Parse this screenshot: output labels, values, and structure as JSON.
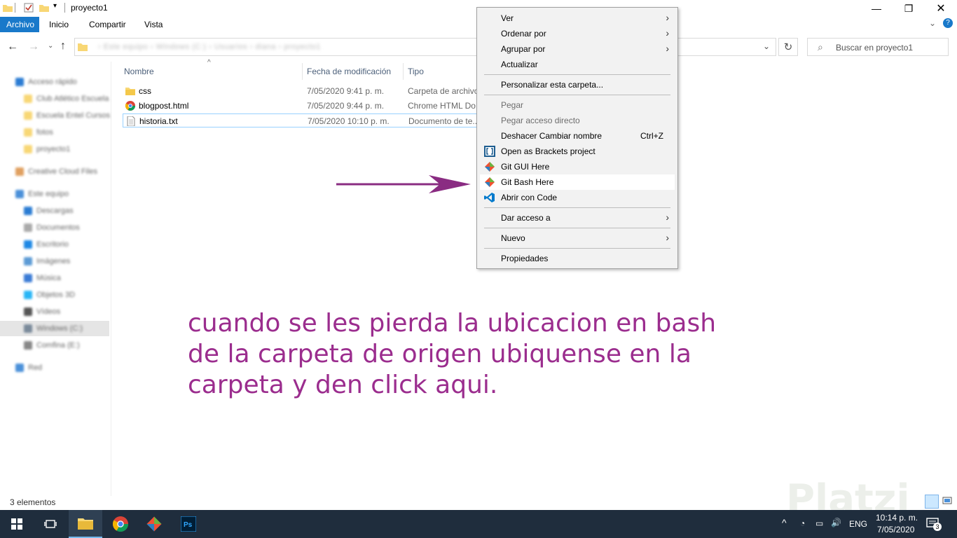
{
  "window": {
    "title": "proyecto1"
  },
  "ribbon": {
    "tabs": [
      "Archivo",
      "Inicio",
      "Compartir",
      "Vista"
    ]
  },
  "address": {
    "path": "› Este equipo › Windows (C:) › Usuarios › diana › proyecto1"
  },
  "search": {
    "placeholder": "Buscar en proyecto1"
  },
  "navpane": {
    "items": [
      "Acceso rápido",
      "Club Atlético Escuela",
      "Escuela Entel Cursos",
      "fotos",
      "proyecto1",
      "Creative Cloud Files",
      "Este equipo",
      "Descargas",
      "Documentos",
      "Escritorio",
      "Imágenes",
      "Música",
      "Objetos 3D",
      "Vídeos",
      "Windows (C:)",
      "Comfina (E:)",
      "Red"
    ]
  },
  "filelist": {
    "columns": {
      "name": "Nombre",
      "date": "Fecha de modificación",
      "type": "Tipo"
    },
    "rows": [
      {
        "name": "css",
        "date": "7/05/2020 9:41 p. m.",
        "type": "Carpeta de archivos",
        "icon": "folder-icon"
      },
      {
        "name": "blogpost.html",
        "date": "7/05/2020 9:44 p. m.",
        "type": "Chrome HTML Do...",
        "icon": "chrome-icon"
      },
      {
        "name": "historia.txt",
        "date": "7/05/2020 10:10 p. m.",
        "type": "Documento de te...",
        "icon": "text-file-icon"
      }
    ]
  },
  "contextmenu": {
    "ver": "Ver",
    "ordenar": "Ordenar por",
    "agrupar": "Agrupar por",
    "actualizar": "Actualizar",
    "personalizar": "Personalizar esta carpeta...",
    "pegar": "Pegar",
    "pegar_acceso": "Pegar acceso directo",
    "deshacer": "Deshacer Cambiar nombre",
    "deshacer_shortcut": "Ctrl+Z",
    "brackets": "Open as Brackets project",
    "git_gui": "Git GUI Here",
    "git_bash": "Git Bash Here",
    "code": "Abrir con Code",
    "dar_acceso": "Dar acceso a",
    "nuevo": "Nuevo",
    "propiedades": "Propiedades"
  },
  "annotation": {
    "text": "cuando se les pierda la ubicacion en bash de la carpeta de origen ubiquense en la carpeta y den click aqui.",
    "color": "#9b2d8e"
  },
  "status": {
    "count": "3 elementos"
  },
  "taskbar": {
    "lang": "ENG",
    "time": "10:14 p. m.",
    "date": "7/05/2020",
    "notifications": "3"
  },
  "watermark": "Platzi",
  "colors": {
    "accent": "#1979ca",
    "taskbar": "#1f2d3d"
  }
}
